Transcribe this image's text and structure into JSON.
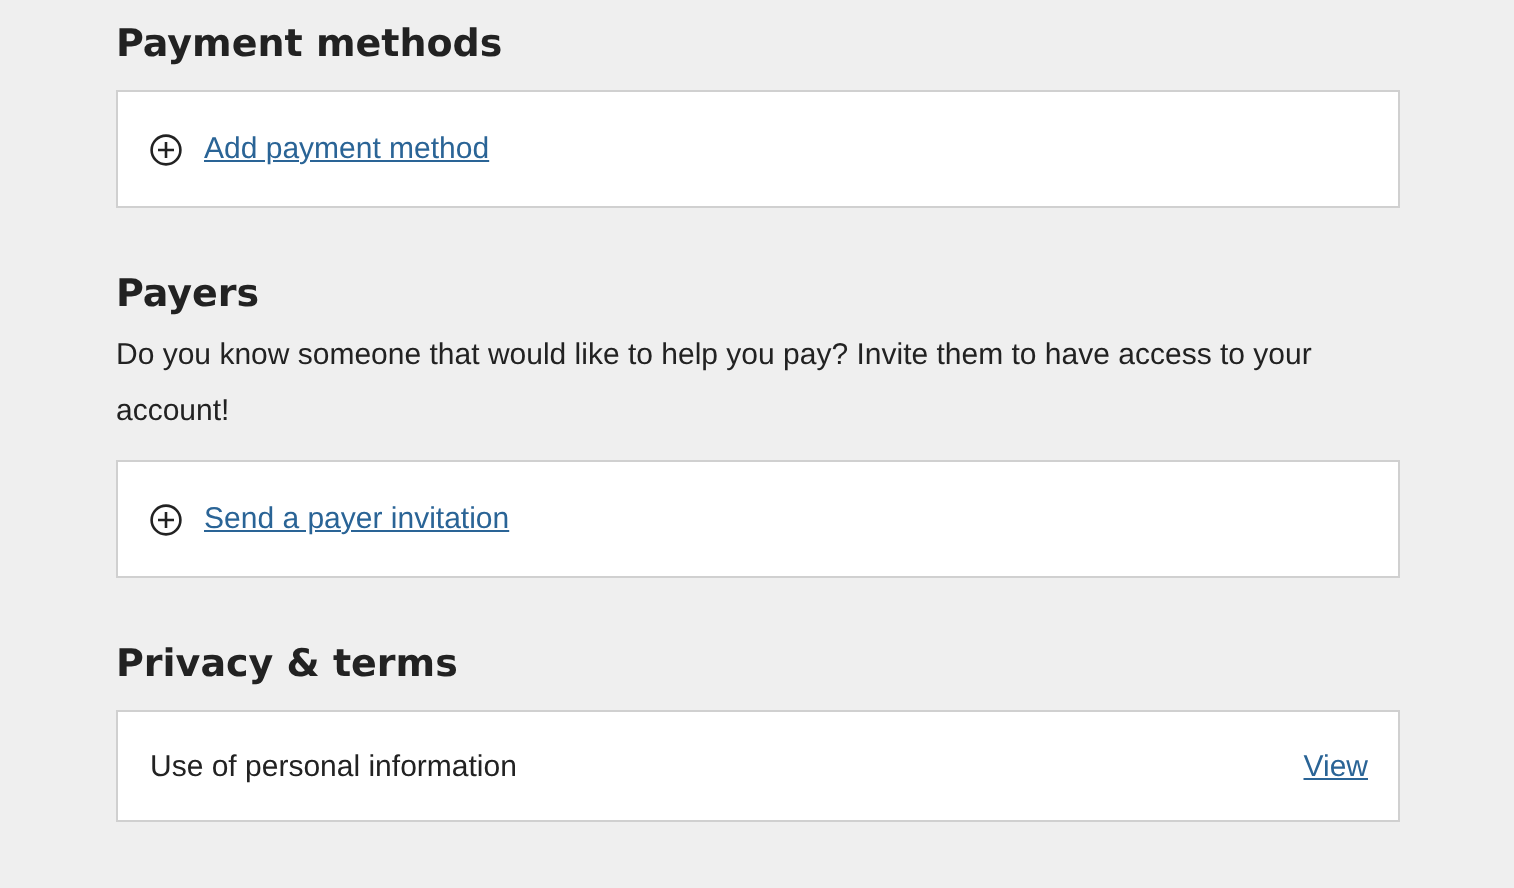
{
  "sections": [
    {
      "title": "Payment methods",
      "rows": [
        {
          "kind": "add",
          "link": "Add payment method"
        }
      ]
    },
    {
      "title": "Payers",
      "description": "Do you know someone that would like to help you pay? Invite them to have access to your account!",
      "rows": [
        {
          "kind": "add",
          "link": "Send a payer invitation"
        }
      ]
    },
    {
      "title": "Privacy & terms",
      "rows": [
        {
          "kind": "item",
          "label": "Use of personal information",
          "link": "View"
        }
      ]
    }
  ]
}
